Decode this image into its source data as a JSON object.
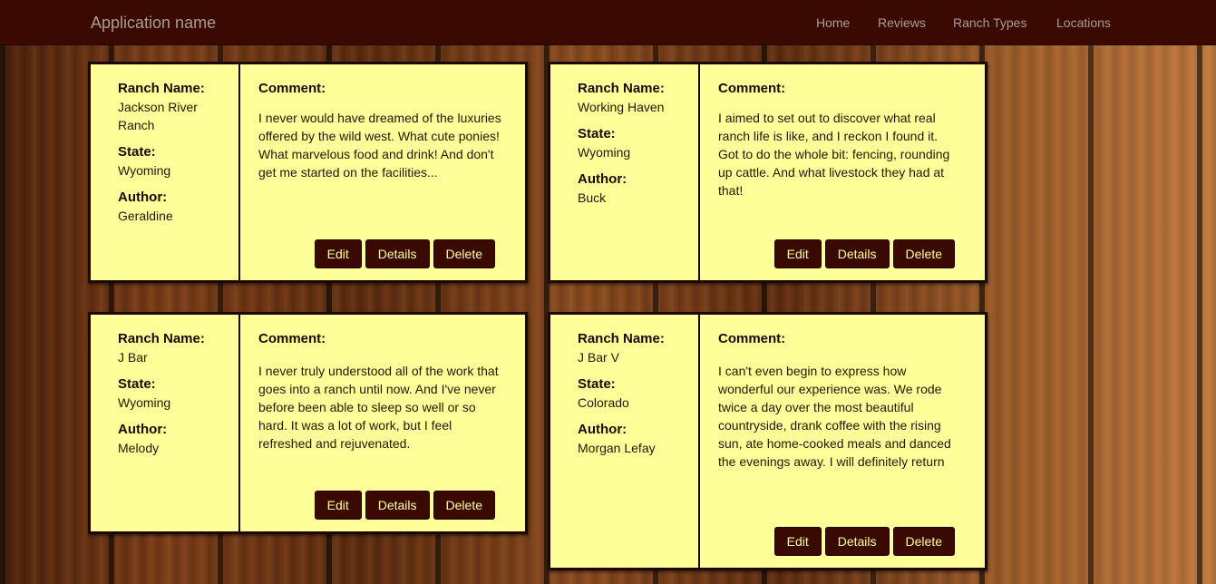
{
  "nav": {
    "brand": "Application name",
    "links": [
      "Home",
      "Reviews",
      "Ranch Types",
      "Locations"
    ]
  },
  "labels": {
    "ranch_name": "Ranch Name:",
    "state": "State:",
    "author": "Author:",
    "comment": "Comment:",
    "edit": "Edit",
    "details": "Details",
    "delete": "Delete"
  },
  "reviews": [
    {
      "ranch_name": "Jackson River Ranch",
      "state": "Wyoming",
      "author": "Geraldine",
      "comment": "I never would have dreamed of the luxuries offered by the wild west. What cute ponies! What marvelous food and drink! And don't get me started on the facilities..."
    },
    {
      "ranch_name": "Working Haven",
      "state": "Wyoming",
      "author": "Buck",
      "comment": "I aimed to set out to discover what real ranch life is like, and I reckon I found it. Got to do the whole bit: fencing, rounding up cattle. And what livestock they had at that!"
    },
    {
      "ranch_name": "J Bar",
      "state": "Wyoming",
      "author": "Melody",
      "comment": "I never truly understood all of the work that goes into a ranch until now. And I've never before been able to sleep so well or so hard. It was a lot of work, but I feel refreshed and rejuvenated."
    },
    {
      "ranch_name": "J Bar V",
      "state": "Colorado",
      "author": "Morgan Lefay",
      "comment": "I can't even begin to express how wonderful our experience was. We rode twice a day over the most beautiful countryside, drank coffee with the rising sun, ate home-cooked meals and danced the evenings away. I will definitely return"
    }
  ],
  "colors": {
    "navbar": "#3a0a02",
    "card": "#ffff99",
    "button": "#3a0a02",
    "button_text": "#ffff99"
  }
}
